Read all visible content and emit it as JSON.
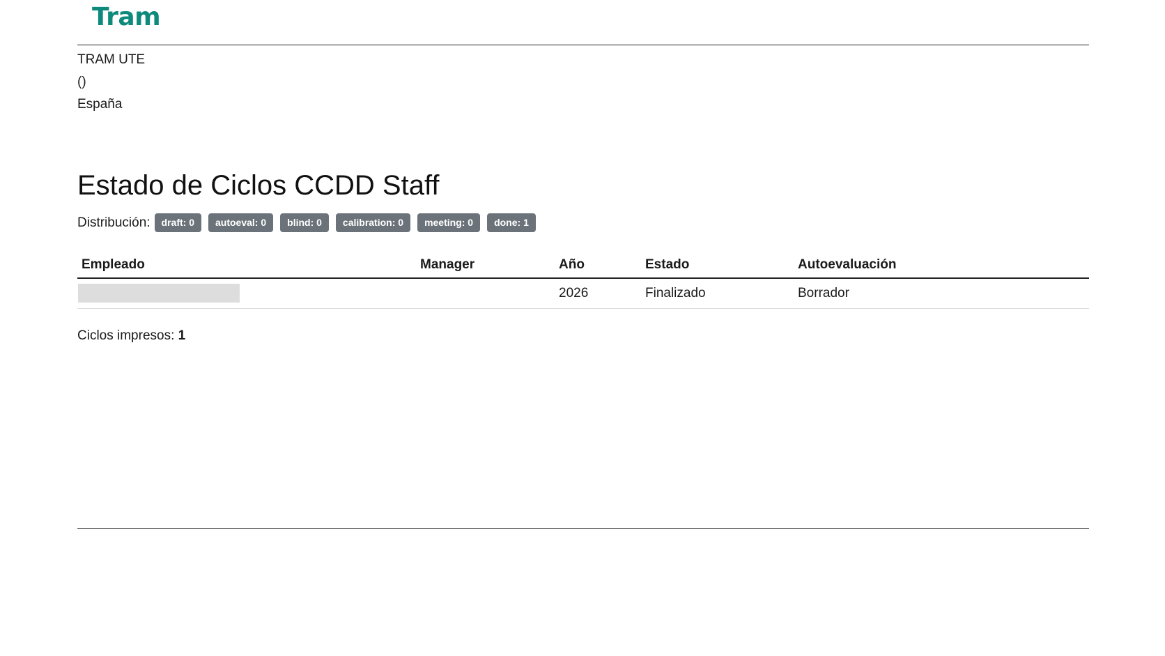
{
  "brand": {
    "logo_text": "Tram",
    "logo_color": "#0e8a7d"
  },
  "company": {
    "name": "TRAM UTE",
    "line2": "()",
    "country": "España"
  },
  "report": {
    "title": "Estado de Ciclos CCDD Staff",
    "distribution_label": "Distribución:",
    "badges": [
      "draft: 0",
      "autoeval: 0",
      "blind: 0",
      "calibration: 0",
      "meeting: 0",
      "done: 1"
    ],
    "badge_color": "#6b727a"
  },
  "table": {
    "headers": {
      "employee": "Empleado",
      "manager": "Manager",
      "year": "Año",
      "status": "Estado",
      "self_eval": "Autoevaluación"
    },
    "rows": [
      {
        "employee": "",
        "manager": "",
        "year": "2026",
        "status": "Finalizado",
        "self_eval": "Borrador"
      }
    ]
  },
  "footer": {
    "printed_label": "Ciclos impresos:",
    "printed_count": "1"
  }
}
